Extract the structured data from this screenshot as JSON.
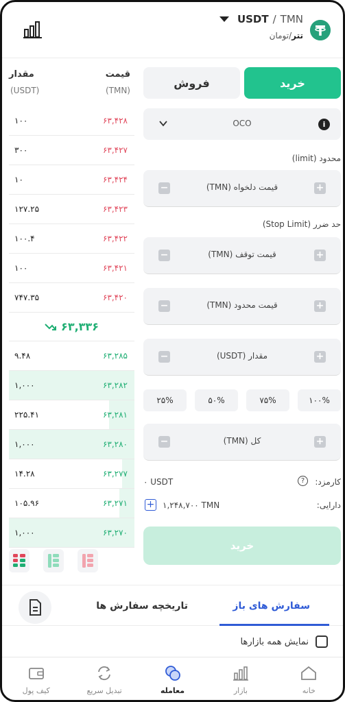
{
  "header": {
    "base": "USDT",
    "quote": "TMN",
    "sub_base": "تتر",
    "sub_quote": "تومان"
  },
  "book": {
    "price_header": "قیمت",
    "price_unit": "(TMN)",
    "amount_header": "مقدار",
    "amount_unit": "(USDT)",
    "sells": [
      {
        "price": "۶۳,۴۲۸",
        "amount": "۱۰۰"
      },
      {
        "price": "۶۳,۴۲۷",
        "amount": "۳۰۰"
      },
      {
        "price": "۶۳,۴۲۴",
        "amount": "۱۰"
      },
      {
        "price": "۶۳,۴۲۳",
        "amount": "۱۲۷.۲۵"
      },
      {
        "price": "۶۳,۴۲۲",
        "amount": "۱۰۰.۴"
      },
      {
        "price": "۶۳,۴۲۱",
        "amount": "۱۰۰"
      },
      {
        "price": "۶۳,۴۲۰",
        "amount": "۷۴۷.۳۵"
      }
    ],
    "last_price": "۶۳,۳۳۶",
    "buys": [
      {
        "price": "۶۳,۲۸۵",
        "amount": "۹.۴۸",
        "depth": 0
      },
      {
        "price": "۶۳,۲۸۲",
        "amount": "۱,۰۰۰",
        "depth": 1.0
      },
      {
        "price": "۶۳,۲۸۱",
        "amount": "۲۲۵.۴۱",
        "depth": 0.2
      },
      {
        "price": "۶۳,۲۸۰",
        "amount": "۱,۰۰۰",
        "depth": 1.0
      },
      {
        "price": "۶۳,۲۷۷",
        "amount": "۱۴.۲۸",
        "depth": 0.1
      },
      {
        "price": "۶۳,۲۷۱",
        "amount": "۱۰۵.۹۶",
        "depth": 0.12
      },
      {
        "price": "۶۳,۲۷۰",
        "amount": "۱,۰۰۰",
        "depth": 1.0
      }
    ]
  },
  "form": {
    "buy_tab": "خرید",
    "sell_tab": "فروش",
    "order_type": "OCO",
    "limit_label": "محدود (limit)",
    "desired_price": "قیمت دلخواه (TMN)",
    "stop_limit_label": "حد ضرر (Stop Limit)",
    "stop_price": "قیمت توقف (TMN)",
    "limit_price": "قیمت محدود (TMN)",
    "amount": "مقدار (USDT)",
    "percents": [
      "۱۰۰%",
      "۷۵%",
      "۵۰%",
      "۲۵%"
    ],
    "total": "کل (TMN)",
    "fee_label": "کارمزد:",
    "fee_value": "۰ USDT",
    "balance_label": "دارایی:",
    "balance_value": "۱,۲۴۸,۷۰۰  TMN",
    "submit": "خرید",
    "plus": "+",
    "minus": "−",
    "info": "i",
    "question": "?"
  },
  "orders": {
    "open_tab": "سفارش های باز",
    "history_tab": "تاریخچه سفارش ها",
    "show_all": "نمایش همه بازارها"
  },
  "nav": [
    {
      "label": "خانه",
      "icon": "home-icon"
    },
    {
      "label": "بازار",
      "icon": "market-icon"
    },
    {
      "label": "معامله",
      "icon": "trade-icon"
    },
    {
      "label": "تبدیل سریع",
      "icon": "convert-icon"
    },
    {
      "label": "کیف پول",
      "icon": "wallet-icon"
    }
  ],
  "colors": {
    "buy": "#22c38e",
    "sell": "#e0465a",
    "accent": "#2f5bd6"
  }
}
